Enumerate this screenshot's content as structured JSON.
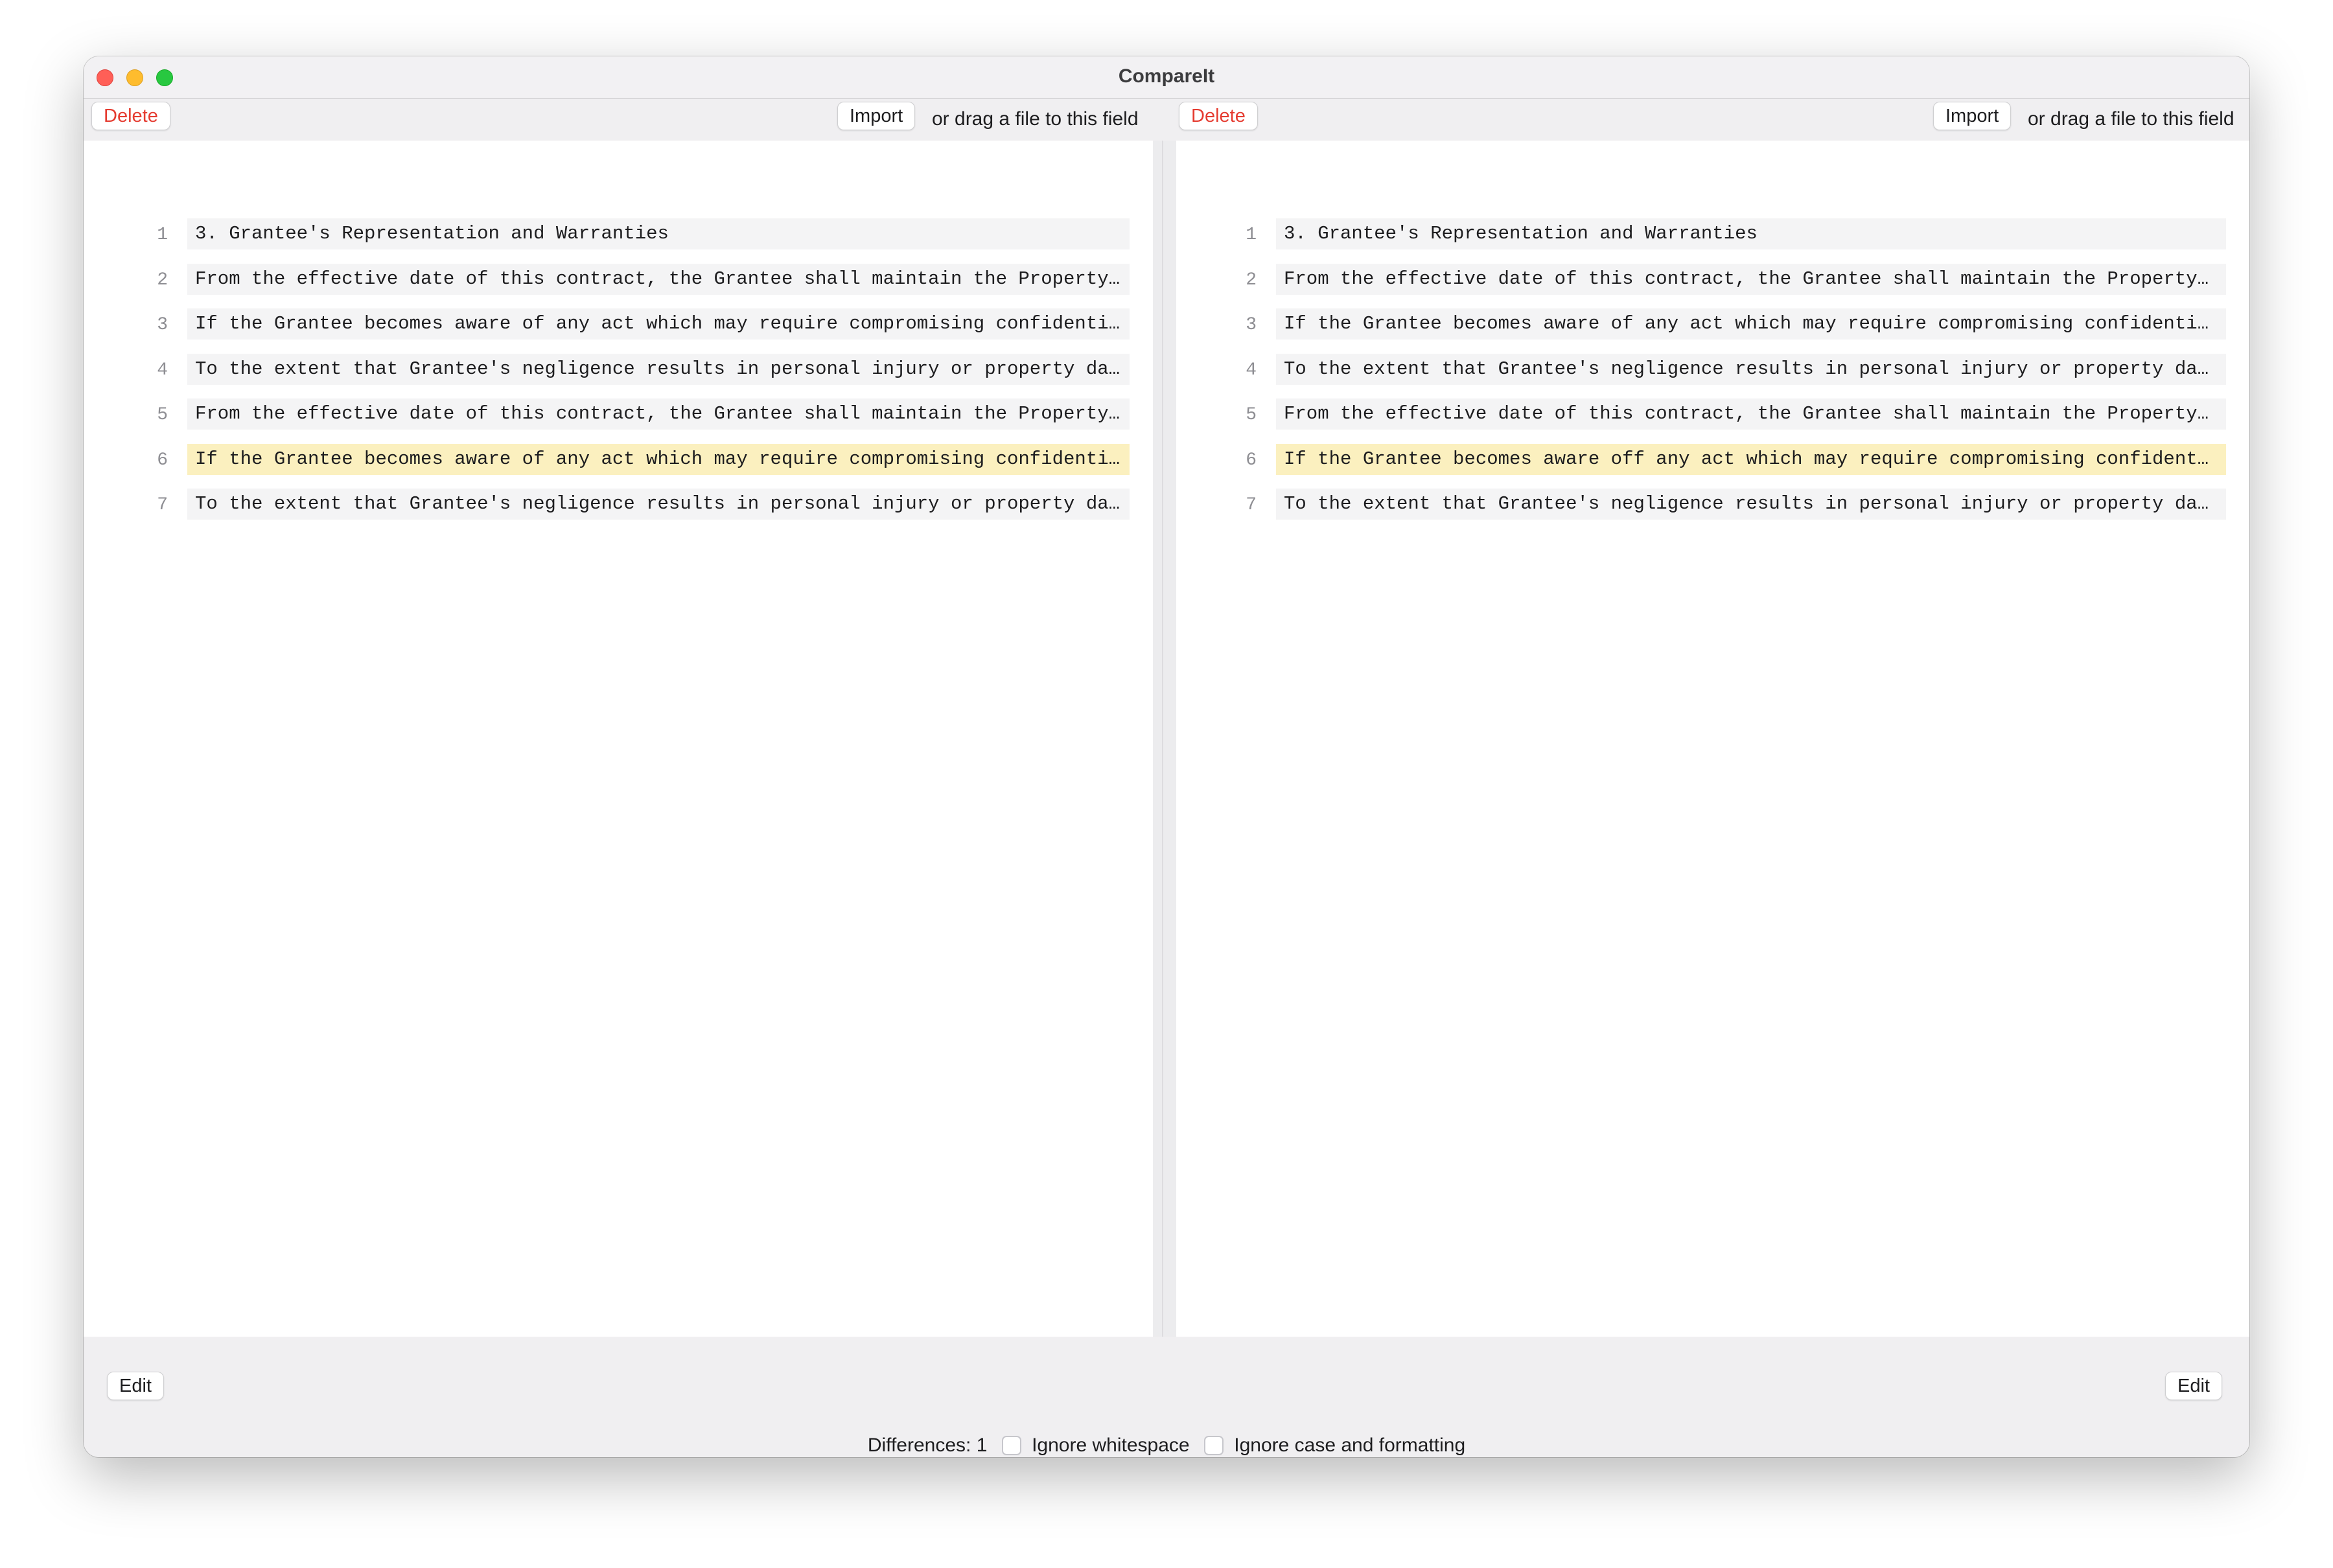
{
  "window": {
    "title": "CompareIt"
  },
  "left": {
    "delete_label": "Delete",
    "import_label": "Import",
    "hint": "or drag a file to this field",
    "edit_label": "Edit",
    "lines": [
      {
        "num": "1",
        "text": "3. Grantee's Representation and Warranties"
      },
      {
        "num": "2",
        "text": "From the effective date of this contract, the Grantee shall maintain the Property in good condition and repair at all times."
      },
      {
        "num": "3",
        "text": "If the Grantee becomes aware of any act which may require compromising confidentiality, the Grantee shall notify the Grantor."
      },
      {
        "num": "4",
        "text": "To the extent that Grantee's negligence results in personal injury or property damage, the Grantee shall indemnify the Grantor."
      },
      {
        "num": "5",
        "text": "From the effective date of this contract, the Grantee shall maintain the Property in good condition and repair at all times."
      },
      {
        "num": "6",
        "text": "If the Grantee becomes aware of any act which may require compromising confidentiality, the Grantee shall notify the Grantor."
      },
      {
        "num": "7",
        "text": "To the extent that Grantee's negligence results in personal injury or property damage, the Grantee shall indemnify the Grantor."
      }
    ]
  },
  "right": {
    "delete_label": "Delete",
    "import_label": "Import",
    "hint": "or drag a file to this field",
    "edit_label": "Edit",
    "lines": [
      {
        "num": "1",
        "text": "3. Grantee's Representation and Warranties"
      },
      {
        "num": "2",
        "text": "From the effective date of this contract, the Grantee shall maintain the Property in good condition and repair at all times."
      },
      {
        "num": "3",
        "text": "If the Grantee becomes aware of any act which may require compromising confidentiality, the Grantee shall notify the Grantor."
      },
      {
        "num": "4",
        "text": "To the extent that Grantee's negligence results in personal injury or property damage, the Grantee shall indemnify the Grantor."
      },
      {
        "num": "5",
        "text": "From the effective date of this contract, the Grantee shall maintain the Property in good condition and repair at all times."
      },
      {
        "num": "6",
        "text": "If the Grantee becomes aware off any act which may require compromising confidentiality, the Grantee shall notify the Grantor."
      },
      {
        "num": "7",
        "text": "To the extent that Grantee's negligence results in personal injury or property damage, the Grantee shall indemnify the Grantor."
      }
    ]
  },
  "status": {
    "differences": "Differences: 1",
    "ignore_whitespace": "Ignore whitespace",
    "ignore_case": "Ignore case and formatting"
  },
  "colors": {
    "diff_highlight": "#fbf0bf",
    "delete_text": "#e53b30"
  }
}
